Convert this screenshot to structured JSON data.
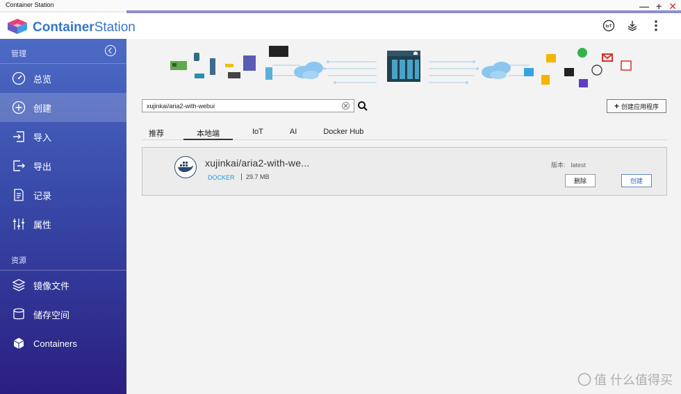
{
  "window": {
    "title": "Container Station",
    "min": "—",
    "max": "+",
    "close": "✕"
  },
  "app": {
    "brand_a": "Container",
    "brand_b": "Station"
  },
  "header_icons": [
    "iot-icon",
    "stack-icon",
    "more-icon"
  ],
  "sidebar": {
    "section_manage": "管理",
    "section_resources": "资源",
    "manage_items": [
      {
        "label": "总览",
        "icon": "dashboard-icon"
      },
      {
        "label": "创建",
        "icon": "plus-circle-icon"
      },
      {
        "label": "导入",
        "icon": "import-icon"
      },
      {
        "label": "导出",
        "icon": "export-icon"
      },
      {
        "label": "记录",
        "icon": "log-icon"
      },
      {
        "label": "属性",
        "icon": "settings-sliders-icon"
      }
    ],
    "resource_items": [
      {
        "label": "镜像文件",
        "icon": "layers-icon"
      },
      {
        "label": "储存空间",
        "icon": "storage-icon"
      },
      {
        "label": "Containers",
        "icon": "cube-icon"
      }
    ],
    "active": "创建"
  },
  "search": {
    "value": "xujinkai/aria2-with-webui",
    "placeholder": ""
  },
  "create_app_label": "创建应用程序",
  "tabs": [
    "推荐",
    "本地端",
    "IoT",
    "AI",
    "Docker Hub"
  ],
  "active_tab": "本地端",
  "image": {
    "name": "xujinkai/aria2-with-we...",
    "type": "DOCKER",
    "size": "29.7 MB",
    "version_label": "版本:",
    "version": "latest",
    "delete_label": "删除",
    "create_label": "创建"
  },
  "watermark": "值 什么值得买",
  "colors": {
    "accent": "#3575c9",
    "sidebar_top": "#4c6bc5",
    "sidebar_bottom": "#2a1f80",
    "docker": "#1b9bd7"
  }
}
